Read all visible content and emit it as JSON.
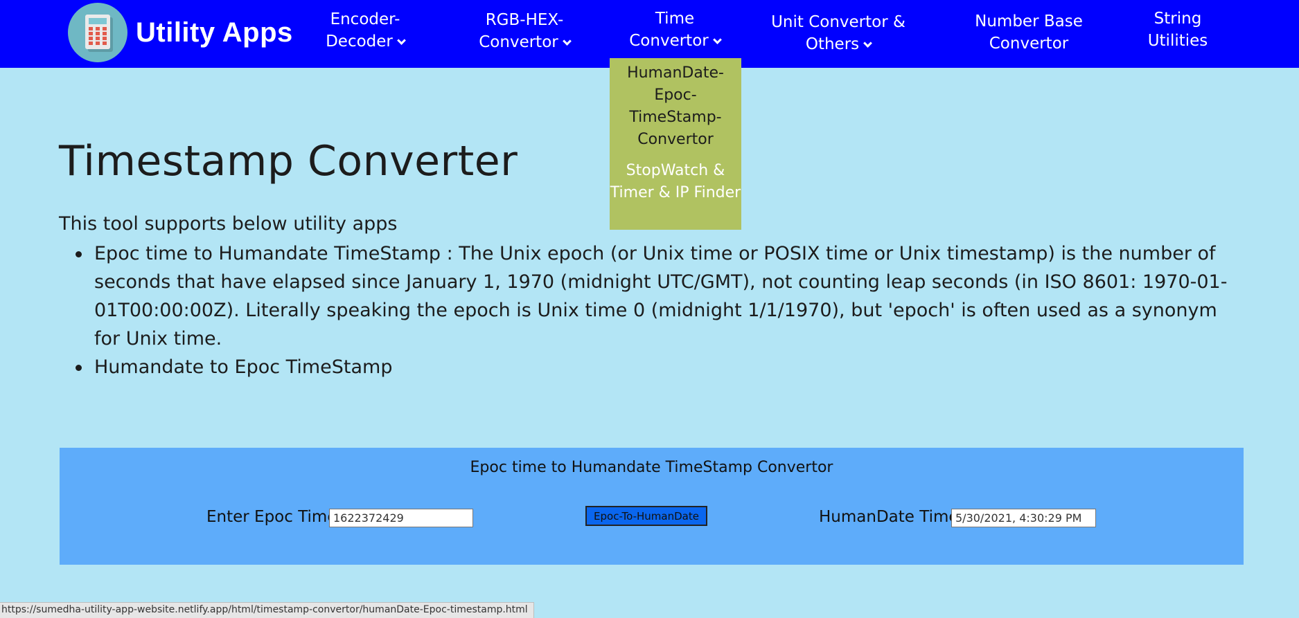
{
  "nav": {
    "brand": "Utility Apps",
    "items": [
      {
        "line1": "Encoder-",
        "line2": "Decoder",
        "has_dropdown": true
      },
      {
        "line1": "RGB-HEX-",
        "line2": "Convertor",
        "has_dropdown": true
      },
      {
        "line1": "Time",
        "line2": "Convertor",
        "has_dropdown": true
      },
      {
        "line1": "Unit Convertor &",
        "line2": "Others",
        "has_dropdown": true
      },
      {
        "line1": "Number Base",
        "line2": "Convertor",
        "has_dropdown": false
      },
      {
        "line1": "String",
        "line2": "Utilities",
        "has_dropdown": false
      }
    ],
    "dropdown": {
      "item1": "HumanDate-Epoc-TimeStamp-Convertor",
      "item2": "StopWatch & Timer & IP Finder"
    }
  },
  "page": {
    "title": "Timestamp Converter",
    "intro": "This tool supports below utility apps",
    "features": [
      "Epoc time to Humandate TimeStamp : The Unix epoch (or Unix time or POSIX time or Unix timestamp) is the number of seconds that have elapsed since January 1, 1970 (midnight UTC/GMT), not counting leap seconds (in ISO 8601: 1970-01-01T00:00:00Z). Literally speaking the epoch is Unix time 0 (midnight 1/1/1970), but 'epoch' is often used as a synonym for Unix time.",
      "Humandate to Epoc TimeStamp"
    ]
  },
  "converter": {
    "title": "Epoc time to Humandate TimeStamp Convertor",
    "epoc_label": "Enter Epoc Time",
    "epoc_value": "1622372429",
    "button_label": "Epoc-To-HumanDate",
    "human_label": "HumanDate Time",
    "human_value": "5/30/2021, 4:30:29 PM"
  },
  "status_url": "https://sumedha-utility-app-website.netlify.app/html/timestamp-convertor/humanDate-Epoc-timestamp.html",
  "colors": {
    "nav_bg": "#0000ff",
    "page_bg": "#b3e5f5",
    "dropdown_bg": "#b0c261",
    "panel_bg": "#5eacfa",
    "button_bg": "#0a66ee"
  }
}
